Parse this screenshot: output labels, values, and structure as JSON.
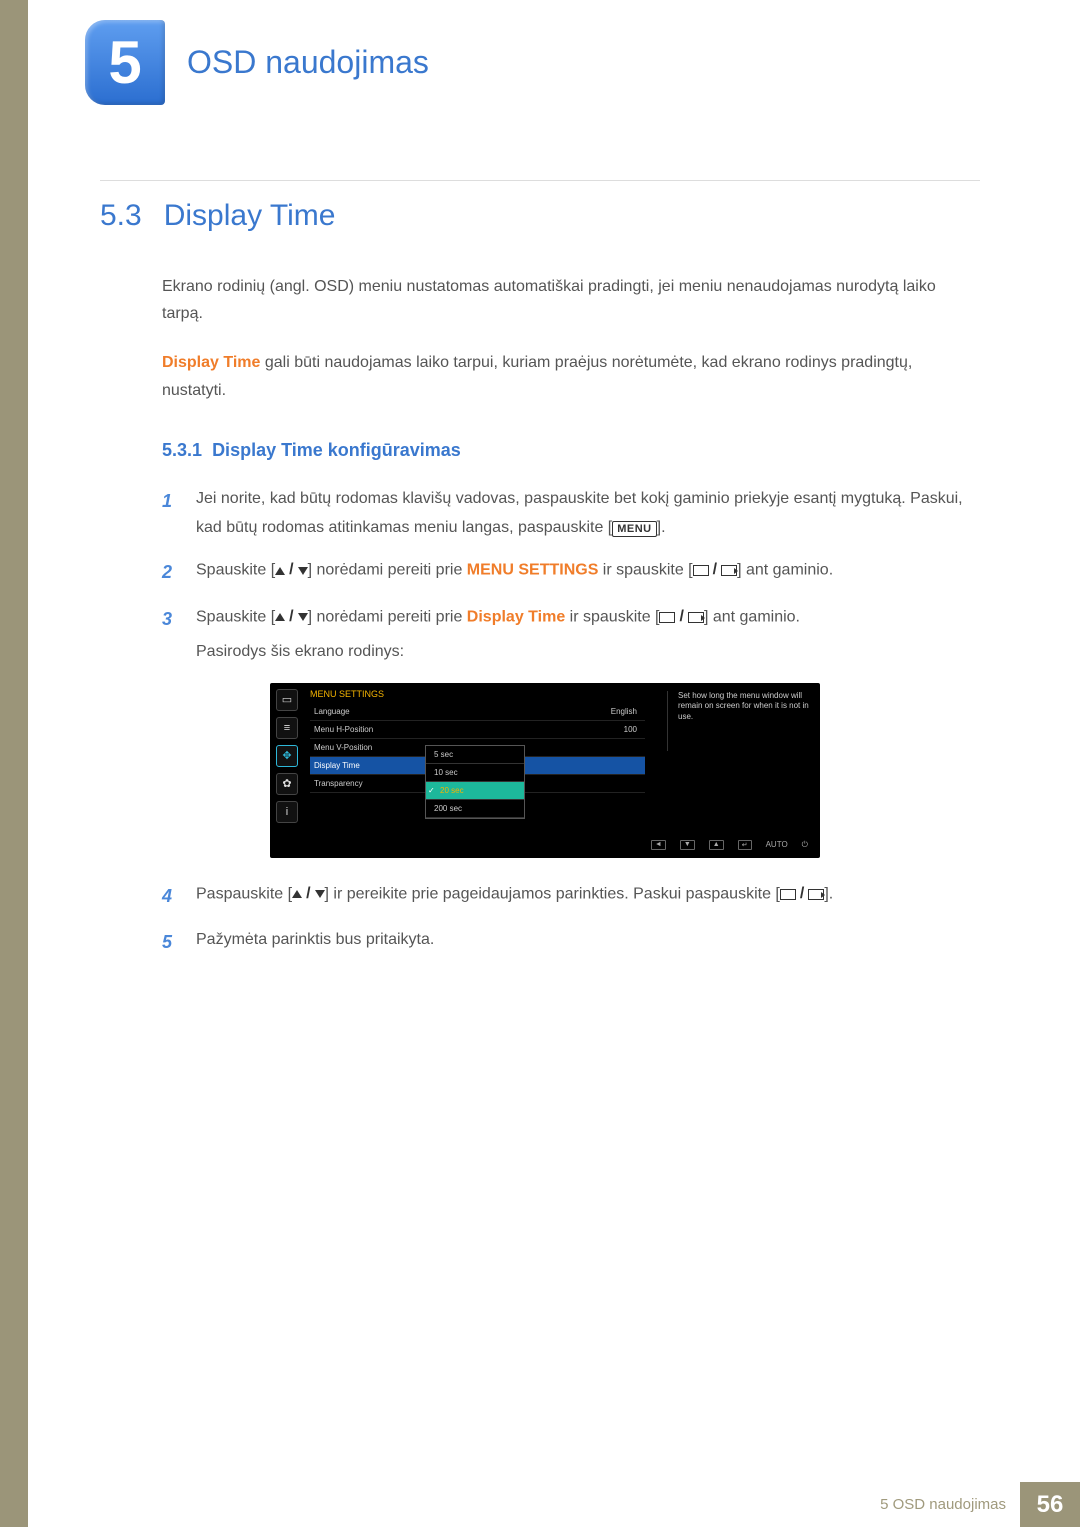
{
  "chapter": {
    "number": "5",
    "title": "OSD naudojimas"
  },
  "section": {
    "number": "5.3",
    "title": "Display Time"
  },
  "intro": {
    "p1": "Ekrano rodinių (angl. OSD) meniu nustatomas automatiškai pradingti, jei meniu nenaudojamas nurodytą laiko tarpą.",
    "p2_bold": "Display Time",
    "p2_rest": " gali būti naudojamas laiko tarpui, kuriam praėjus norėtumėte, kad ekrano rodinys pradingtų, nustatyti."
  },
  "subsection": {
    "number": "5.3.1",
    "title": "Display Time konfigūravimas"
  },
  "steps": {
    "s1": {
      "n": "1",
      "a": "Jei norite, kad būtų rodomas klavišų vadovas, paspauskite bet kokį gaminio priekyje esantį mygtuką. Paskui, kad būtų rodomas atitinkamas meniu langas, paspauskite [",
      "menu": "MENU",
      "b": "]."
    },
    "s2": {
      "n": "2",
      "a": "Spauskite [",
      "b": "] norėdami pereiti prie ",
      "kw": "MENU SETTINGS",
      "c": " ir spauskite [",
      "d": "] ant gaminio."
    },
    "s3": {
      "n": "3",
      "a": "Spauskite [",
      "b": "] norėdami pereiti prie ",
      "kw": "Display Time",
      "c": " ir spauskite [",
      "d": "] ant gaminio.",
      "e": "Pasirodys šis ekrano rodinys:"
    },
    "s4": {
      "n": "4",
      "a": "Paspauskite [",
      "b": "] ir pereikite prie pageidaujamos parinkties. Paskui paspauskite [",
      "c": "]."
    },
    "s5": {
      "n": "5",
      "a": "Pažymėta parinktis bus pritaikyta."
    }
  },
  "osd": {
    "title": "MENU SETTINGS",
    "rows": [
      {
        "label": "Language",
        "value": "English"
      },
      {
        "label": "Menu H-Position",
        "value": "100"
      },
      {
        "label": "Menu V-Position",
        "value": ""
      },
      {
        "label": "Display Time",
        "value": ""
      },
      {
        "label": "Transparency",
        "value": ""
      }
    ],
    "dropdown": [
      "5 sec",
      "10 sec",
      "20 sec",
      "200 sec"
    ],
    "hint": "Set how long the menu window will remain on screen for when it is not in use.",
    "bottom_auto": "AUTO"
  },
  "footer": {
    "text": "5 OSD naudojimas",
    "page": "56"
  }
}
